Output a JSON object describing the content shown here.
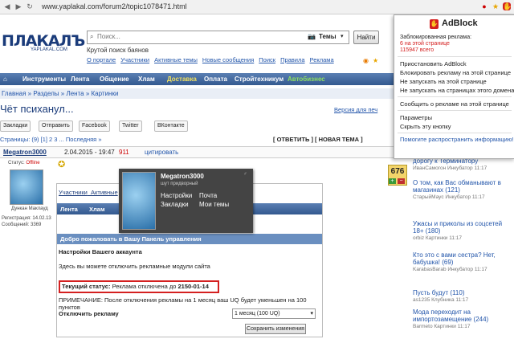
{
  "browser": {
    "url": "www.yaplakal.com/forum2/topic1078471.html"
  },
  "site": {
    "logo_text": "ПЛАКАЛЪ",
    "logo_sub": "YAPLAKAL.COM",
    "search": {
      "placeholder": "Поиск...",
      "scope": "Темы",
      "button": "Найти"
    },
    "tagline": "Крутой поиск баянов",
    "top_links": [
      "О портале",
      "Участники",
      "Активные темы",
      "Новые сообщения",
      "Поиск",
      "Правила",
      "Реклама"
    ],
    "nav": [
      "Инструменты",
      "Лента",
      "Общение",
      "Хлам",
      "Доставка",
      "Оплата",
      "Стройтехникум",
      "Автобизнес"
    ],
    "breadcrumb": [
      "Главная",
      "Разделы",
      "Лента",
      "Картинки"
    ],
    "topic_title": "Чёт психанул...",
    "print_link": "Версия для печ",
    "share": [
      "Закладки",
      "Отправить",
      "Facebook",
      "Twitter",
      "ВКонтакте"
    ],
    "pages": "Страницы: (9) [1] 2 3 ... Последняя »",
    "reply_actions": "[ ОТВЕТИТЬ ] [ НОВАЯ ТЕМА ]"
  },
  "post": {
    "author": "Megatron3000",
    "date": "2.04.2015 - 19:47",
    "post_id": "911",
    "quote": "цитировать",
    "rating": "676",
    "status_label": "Статус:",
    "status_value": "Offline",
    "user_caption": "Дункан Маклауд",
    "registered": "Регистрация: 14.02.13",
    "messages": "Сообщений: 3369"
  },
  "embedded": {
    "tabs": [
      "Участники",
      "Активные"
    ],
    "panel_title": "Добро пожаловать в Вашу Панель управления",
    "section": "Настройки Вашего аккаунта",
    "desc": "Здесь вы можете отключить рекламные модули сайта",
    "status_label": "Текущий статус:",
    "status_text": "Реклама отключена до",
    "status_date": "2150-01-14",
    "note": "ПРИМЕЧАНИЕ: После отключения рекламы на 1 месяц ваш UQ будет уменьшен на 100 пунктов",
    "disable_label": "Отключить рекламу",
    "period": "1 месяц (100 UQ)",
    "save": "Сохранить изменения"
  },
  "popup": {
    "name": "Megatron3000",
    "role": "шут придворный",
    "links": [
      "Настройки",
      "Почта",
      "Закладки",
      "Мои темы"
    ]
  },
  "adblock": {
    "title": "AdBlock",
    "blocked_label": "Заблокированная реклама:",
    "on_page": "6 на этой странице",
    "total": "115947 всего",
    "items": [
      "Приостановить AdBlock",
      "Блокировать рекламу на этой странице",
      "Не запускать на этой странице",
      "Не запускать на страницах этого домена"
    ],
    "report": "Сообщить о рекламе на этой странице",
    "options": "Параметры",
    "hide": "Скрыть эту кнопку",
    "spread": "Помогите распространить информацию!"
  },
  "sidebar": [
    {
      "title": "дорогу к Терминатору",
      "meta": "ИванСамогон  Инкубатор  11:17"
    },
    {
      "title": "О том, как Вас обманывают в магазинах (121)",
      "meta": "СтарыйМаус  Инкубатор  11:17"
    },
    {
      "title": "Ужасы и приколы из соцсетей 18+ (180)",
      "meta": "orbiz  Картинки  11:17"
    },
    {
      "title": "Кто это с вами сестра? Нет, бабушка! (69)",
      "meta": "KarabasBarab  Инкубатор  11:17"
    },
    {
      "title": "Пусть будут (110)",
      "meta": "as1235  Клубника  11:17"
    },
    {
      "title": "Мода переходит на импортозамещение (244)",
      "meta": "Barmeto  Картинки  11:17"
    }
  ],
  "colors": {
    "nav": "#33598f",
    "accent": "#2255aa",
    "adblock_red": "#d42020",
    "status_box": "#d42020"
  }
}
